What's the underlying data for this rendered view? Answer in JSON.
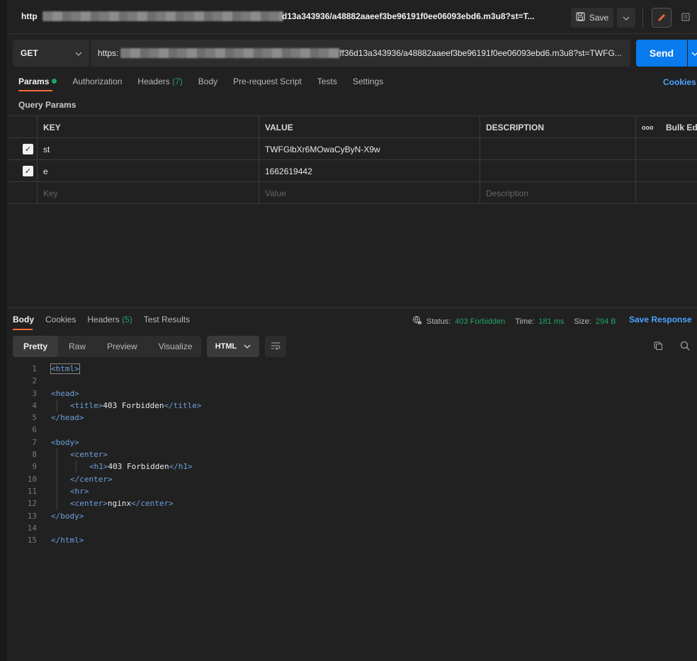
{
  "titlebar": {
    "title_start": "http",
    "title_end": "d13a343936/a48882aaeef3be96191f0ee06093ebd6.m3u8?st=T...",
    "save_label": "Save"
  },
  "request": {
    "method": "GET",
    "url": "https:",
    "url_tail": "ff36d13a343936/a48882aaeef3be96191f0ee06093ebd6.m3u8?st=TWFG...",
    "send_label": "Send"
  },
  "tabs": {
    "params": "Params",
    "authorization": "Authorization",
    "headers": "Headers",
    "headers_count": "(7)",
    "body": "Body",
    "prerequest": "Pre-request Script",
    "tests": "Tests",
    "settings": "Settings",
    "cookies": "Cookies"
  },
  "query_params": {
    "label": "Query Params",
    "headers": {
      "key": "KEY",
      "value": "VALUE",
      "description": "DESCRIPTION",
      "more": "ooo",
      "bulk": "Bulk Ed"
    },
    "rows": [
      {
        "key": "st",
        "value": "TWFGlbXr6MOwaCyByN-X9w",
        "description": ""
      },
      {
        "key": "e",
        "value": "1662619442",
        "description": ""
      }
    ],
    "placeholder": {
      "key": "Key",
      "value": "Value",
      "description": "Description"
    }
  },
  "response": {
    "tabs": {
      "body": "Body",
      "cookies": "Cookies",
      "headers": "Headers",
      "headers_count": "(5)",
      "test_results": "Test Results"
    },
    "status_label": "Status:",
    "status_value": "403 Forbidden",
    "time_label": "Time:",
    "time_value": "181 ms",
    "size_label": "Size:",
    "size_value": "294 B",
    "save_response": "Save Response",
    "view_tabs": {
      "pretty": "Pretty",
      "raw": "Raw",
      "preview": "Preview",
      "visualize": "Visualize"
    },
    "format": "HTML"
  },
  "code_lines": [
    {
      "n": "1",
      "indent": 0,
      "open": "<html>",
      "text": "",
      "close": ""
    },
    {
      "n": "2",
      "indent": 0,
      "open": "",
      "text": "",
      "close": ""
    },
    {
      "n": "3",
      "indent": 0,
      "open": "<head>",
      "text": "",
      "close": ""
    },
    {
      "n": "4",
      "indent": 1,
      "open": "<title>",
      "text": "403 Forbidden",
      "close": "</title>"
    },
    {
      "n": "5",
      "indent": 0,
      "open": "</head>",
      "text": "",
      "close": ""
    },
    {
      "n": "6",
      "indent": 0,
      "open": "",
      "text": "",
      "close": ""
    },
    {
      "n": "7",
      "indent": 0,
      "open": "<body>",
      "text": "",
      "close": ""
    },
    {
      "n": "8",
      "indent": 1,
      "open": "<center>",
      "text": "",
      "close": ""
    },
    {
      "n": "9",
      "indent": 2,
      "open": "<h1>",
      "text": "403 Forbidden",
      "close": "</h1>"
    },
    {
      "n": "10",
      "indent": 1,
      "open": "</center>",
      "text": "",
      "close": ""
    },
    {
      "n": "11",
      "indent": 1,
      "open": "<hr>",
      "text": "",
      "close": ""
    },
    {
      "n": "12",
      "indent": 1,
      "open": "<center>",
      "text": "nginx",
      "close": "</center>"
    },
    {
      "n": "13",
      "indent": 0,
      "open": "</body>",
      "text": "",
      "close": ""
    },
    {
      "n": "14",
      "indent": 0,
      "open": "",
      "text": "",
      "close": ""
    },
    {
      "n": "15",
      "indent": 0,
      "open": "</html>",
      "text": "",
      "close": ""
    }
  ],
  "colors": {
    "accent_orange": "#f26b3a",
    "send_blue": "#097bed",
    "status_green": "#1fa565",
    "link_blue": "#4aa3ff"
  },
  "icons": [
    "save-icon",
    "chevron-down-icon",
    "pencil-icon",
    "document-icon",
    "globe-lock-icon",
    "wrap-lines-icon",
    "copy-icon",
    "search-icon"
  ]
}
